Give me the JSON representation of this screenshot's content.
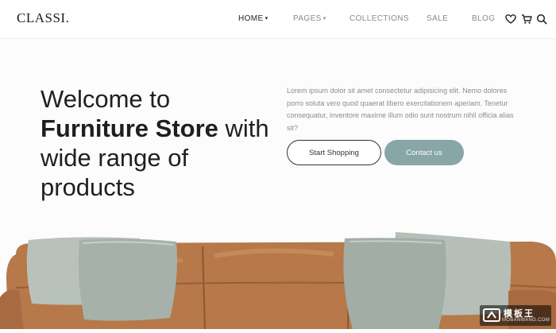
{
  "brand": {
    "logo": "CLASSI."
  },
  "nav": {
    "items": [
      {
        "label": "HOME",
        "caret": "▾"
      },
      {
        "label": "PAGES",
        "caret": "▾"
      },
      {
        "label": "COLLECTIONS"
      },
      {
        "label": "SALE"
      },
      {
        "label": "BLOG"
      }
    ]
  },
  "icons": [
    "heart-icon",
    "cart-icon",
    "search-icon"
  ],
  "hero": {
    "title_part1": "Welcome to",
    "title_bold": "Furniture Store",
    "title_part2": " with wide range of products",
    "description": "Lorem ipsum dolor sit amet consectetur adipisicing elit. Nemo dolores porro soluta vero quod quaerat libero exercitationem aperiam. Tenetur consequatur, inventore maxime illum odio sunt nostrum nihil officia alias sit?",
    "primary_button": "Start Shopping",
    "secondary_button": "Contact us"
  },
  "colors": {
    "accent": "#88a6a7",
    "leather": "#b9794a",
    "pillow": "#a9b3ac"
  },
  "watermark": {
    "main": "模板王",
    "sub": "MOBANWANG.COM"
  }
}
